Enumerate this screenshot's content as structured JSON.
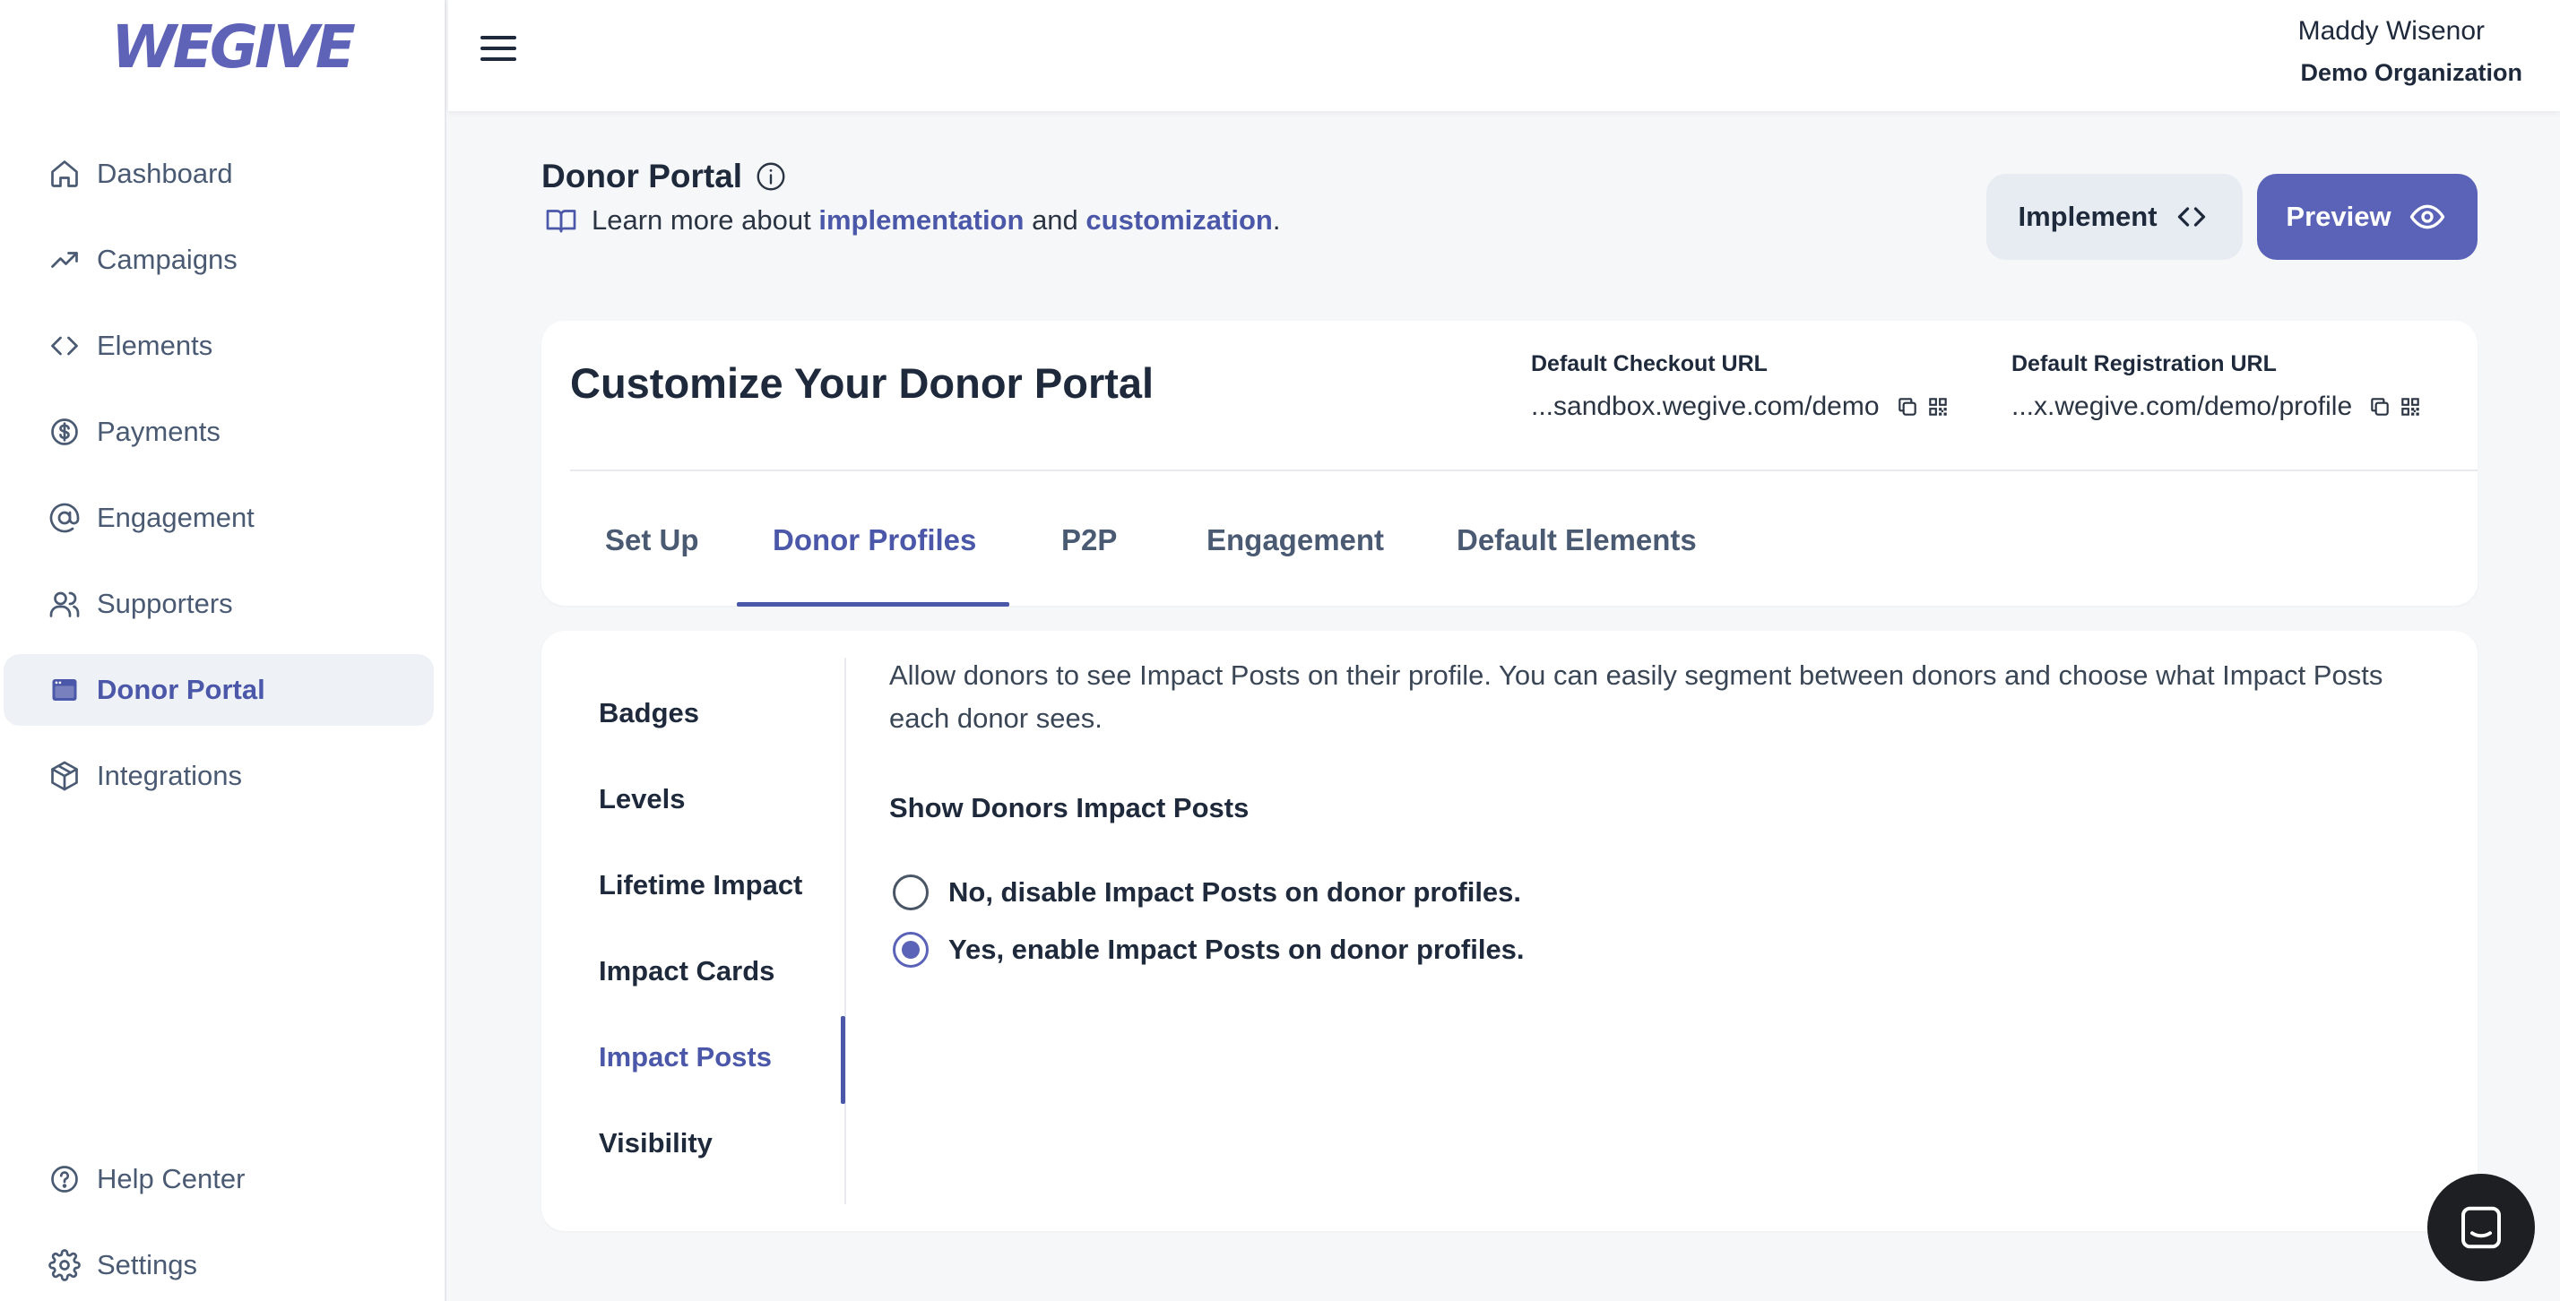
{
  "brand": {
    "logo_text": "WEGIVE",
    "accent": "#5a63b8"
  },
  "sidebar": {
    "items": [
      {
        "label": "Dashboard",
        "icon": "home-icon"
      },
      {
        "label": "Campaigns",
        "icon": "trending-up-icon"
      },
      {
        "label": "Elements",
        "icon": "code-icon"
      },
      {
        "label": "Payments",
        "icon": "dollar-circle-icon"
      },
      {
        "label": "Engagement",
        "icon": "at-sign-icon"
      },
      {
        "label": "Supporters",
        "icon": "users-icon"
      },
      {
        "label": "Donor Portal",
        "icon": "browser-window-icon",
        "active": true
      },
      {
        "label": "Integrations",
        "icon": "cube-icon"
      }
    ],
    "bottom_items": [
      {
        "label": "Help Center",
        "icon": "help-circle-icon"
      },
      {
        "label": "Settings",
        "icon": "gear-icon"
      }
    ]
  },
  "header": {
    "user_name": "Maddy Wisenor",
    "organization": "Demo Organization"
  },
  "page": {
    "title": "Donor Portal",
    "learn_prefix": "Learn more about",
    "learn_link_1": "implementation",
    "learn_and": "and",
    "learn_link_2": "customization",
    "learn_suffix": ".",
    "implement_label": "Implement",
    "preview_label": "Preview"
  },
  "customize": {
    "title": "Customize Your Donor Portal",
    "checkout_url_label": "Default Checkout URL",
    "checkout_url_value": "...sandbox.wegive.com/demo",
    "registration_url_label": "Default Registration URL",
    "registration_url_value": "...x.wegive.com/demo/profile",
    "tabs": [
      "Set Up",
      "Donor Profiles",
      "P2P",
      "Engagement",
      "Default Elements"
    ],
    "active_tab": "Donor Profiles"
  },
  "donor_profiles": {
    "subnav": [
      "Badges",
      "Levels",
      "Lifetime Impact",
      "Impact Cards",
      "Impact Posts",
      "Visibility"
    ],
    "active_subnav": "Impact Posts",
    "description": "Allow donors to see Impact Posts on their profile. You can easily segment between donors and choose what Impact Posts each donor sees.",
    "section_label": "Show Donors Impact Posts",
    "options": [
      {
        "label": "No, disable Impact Posts on donor profiles.",
        "checked": false
      },
      {
        "label": "Yes, enable Impact Posts on donor profiles.",
        "checked": true
      }
    ]
  }
}
